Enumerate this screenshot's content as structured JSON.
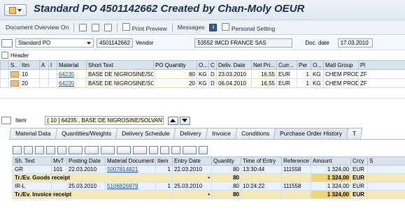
{
  "window": {
    "title": "Standard PO 4501142662 Created by Chan-Moly OEUR"
  },
  "toolbar": {
    "document_overview": "Document Overview On",
    "print_preview": "Print Preview",
    "messages": "Messages",
    "personal_setting": "Personal Setting"
  },
  "header": {
    "doc_type": "Standard PO",
    "po_number": "4501142662",
    "vendor_label": "Vendor",
    "vendor_value": "53552 IMCD FRANCE SAS",
    "doc_date_label": "Doc. date",
    "doc_date_value": "17.03.2010",
    "header_label": "Header"
  },
  "items_table": {
    "columns": [
      "S..",
      "Itm",
      "A",
      "I",
      "Material",
      "Short Text",
      "PO Quantity",
      "O...",
      "C",
      "Deliv. Date",
      "Net Pri...",
      "Curr...",
      "Per",
      "O...",
      "Matl Group",
      "Pl"
    ],
    "rows": [
      {
        "itm": "10",
        "material": "64235",
        "short_text": "BASE DE NIGROSINE/SO...",
        "qty": "80",
        "uom": "KG",
        "c": "D",
        "deliv_date": "23.03.2010",
        "net_price": "16,55",
        "curr": "EUR",
        "per": "1",
        "o": "KG",
        "matl_group": "CHEM PROD...",
        "pl": "ZF"
      },
      {
        "itm": "20",
        "material": "64235",
        "short_text": "BASE DE NIGROSINE/SO...",
        "qty": "20",
        "uom": "KG",
        "c": "D",
        "deliv_date": "06.04.2010",
        "net_price": "16,55",
        "curr": "EUR",
        "per": "1",
        "o": "KG",
        "matl_group": "CHEM PROD...",
        "pl": "ZF"
      }
    ]
  },
  "item_detail": {
    "label": "Item",
    "selected": "[ 10 ] 64235 , BASE DE NIGROSINE/SOLVANT ..."
  },
  "tabs": [
    "Material Data",
    "Quantities/Weights",
    "Delivery Schedule",
    "Delivery",
    "Invoice",
    "Conditions",
    "Purchase Order History",
    "T"
  ],
  "history_table": {
    "columns": [
      "Sh. Text",
      "MvT",
      "Posting Date",
      "Material Document",
      "Item",
      "Entry Date",
      "Quantity",
      "Time of Entry",
      "Reference",
      "Amount",
      "Crcy",
      "S"
    ],
    "rows": [
      {
        "type": "line",
        "sh_text": "GR",
        "mvt": "101",
        "posting_date": "22.03.2010",
        "mat_doc": "5007814821",
        "item": "1",
        "entry_date": "22.03.2010",
        "qty": "80",
        "time": "13:30:44",
        "ref": "111558",
        "amount": "1 324,00",
        "crcy": "EUR"
      },
      {
        "type": "sum",
        "sh_text": "Tr./Ev. Goods receipt",
        "qty": "80",
        "amount": "1 324,00",
        "crcy": "EUR",
        "marker": "•"
      },
      {
        "type": "line",
        "sh_text": "IR-L",
        "mvt": "",
        "posting_date": "25.03.2010",
        "mat_doc": "5106826979",
        "item": "1",
        "entry_date": "25.03.2010",
        "qty": "80",
        "time": "10:24:22",
        "ref": "111558",
        "amount": "1 324,00",
        "crcy": "EUR"
      },
      {
        "type": "sum",
        "sh_text": "Tr./Ev. Invoice receipt",
        "qty": "80",
        "amount": "1 324,00",
        "crcy": "EUR",
        "marker": "•"
      }
    ]
  }
}
